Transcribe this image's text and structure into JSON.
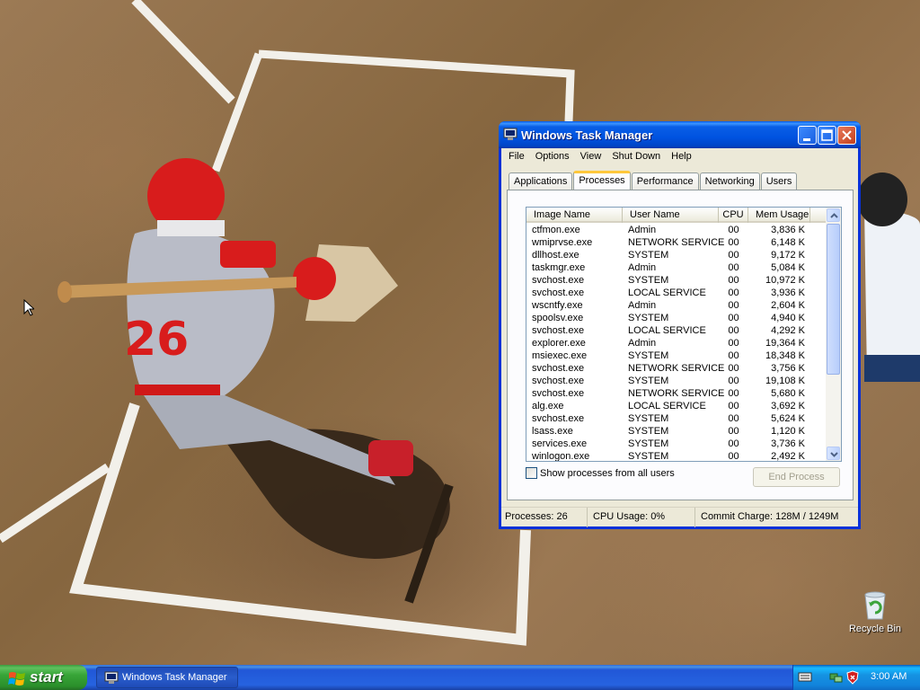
{
  "desktop": {
    "icons": [
      {
        "label": "Recycle Bin",
        "icon": "recycle-bin-icon"
      }
    ]
  },
  "window": {
    "title": "Windows Task Manager",
    "menu": [
      "File",
      "Options",
      "View",
      "Shut Down",
      "Help"
    ],
    "tabs": [
      "Applications",
      "Processes",
      "Performance",
      "Networking",
      "Users"
    ],
    "active_tab": "Processes",
    "columns": [
      "Image Name",
      "User Name",
      "CPU",
      "Mem Usage"
    ],
    "processes": [
      {
        "name": "ctfmon.exe",
        "user": "Admin",
        "cpu": "00",
        "mem": "3,836 K"
      },
      {
        "name": "wmiprvse.exe",
        "user": "NETWORK SERVICE",
        "cpu": "00",
        "mem": "6,148 K"
      },
      {
        "name": "dllhost.exe",
        "user": "SYSTEM",
        "cpu": "00",
        "mem": "9,172 K"
      },
      {
        "name": "taskmgr.exe",
        "user": "Admin",
        "cpu": "00",
        "mem": "5,084 K"
      },
      {
        "name": "svchost.exe",
        "user": "SYSTEM",
        "cpu": "00",
        "mem": "10,972 K"
      },
      {
        "name": "svchost.exe",
        "user": "LOCAL SERVICE",
        "cpu": "00",
        "mem": "3,936 K"
      },
      {
        "name": "wscntfy.exe",
        "user": "Admin",
        "cpu": "00",
        "mem": "2,604 K"
      },
      {
        "name": "spoolsv.exe",
        "user": "SYSTEM",
        "cpu": "00",
        "mem": "4,940 K"
      },
      {
        "name": "svchost.exe",
        "user": "LOCAL SERVICE",
        "cpu": "00",
        "mem": "4,292 K"
      },
      {
        "name": "explorer.exe",
        "user": "Admin",
        "cpu": "00",
        "mem": "19,364 K"
      },
      {
        "name": "msiexec.exe",
        "user": "SYSTEM",
        "cpu": "00",
        "mem": "18,348 K"
      },
      {
        "name": "svchost.exe",
        "user": "NETWORK SERVICE",
        "cpu": "00",
        "mem": "3,756 K"
      },
      {
        "name": "svchost.exe",
        "user": "SYSTEM",
        "cpu": "00",
        "mem": "19,108 K"
      },
      {
        "name": "svchost.exe",
        "user": "NETWORK SERVICE",
        "cpu": "00",
        "mem": "5,680 K"
      },
      {
        "name": "alg.exe",
        "user": "LOCAL SERVICE",
        "cpu": "00",
        "mem": "3,692 K"
      },
      {
        "name": "svchost.exe",
        "user": "SYSTEM",
        "cpu": "00",
        "mem": "5,624 K"
      },
      {
        "name": "lsass.exe",
        "user": "SYSTEM",
        "cpu": "00",
        "mem": "1,120 K"
      },
      {
        "name": "services.exe",
        "user": "SYSTEM",
        "cpu": "00",
        "mem": "3,736 K"
      },
      {
        "name": "winlogon.exe",
        "user": "SYSTEM",
        "cpu": "00",
        "mem": "2,492 K"
      }
    ],
    "show_all_label": "Show processes from all users",
    "show_all_checked": false,
    "end_process_label": "End Process",
    "status": {
      "processes": "Processes: 26",
      "cpu": "CPU Usage: 0%",
      "commit": "Commit Charge: 128M / 1249M"
    }
  },
  "taskbar": {
    "start_label": "start",
    "tasks": [
      {
        "label": "Windows Task Manager",
        "icon": "task-manager-icon"
      }
    ],
    "tray_icons": [
      "keyboard-icon",
      "network-icon",
      "security-shield-icon"
    ],
    "clock": "3:00 AM"
  },
  "colors": {
    "title_blue": "#0058ee",
    "taskbar_blue": "#2663e0",
    "start_green": "#38a538",
    "window_face": "#ece9d8"
  }
}
